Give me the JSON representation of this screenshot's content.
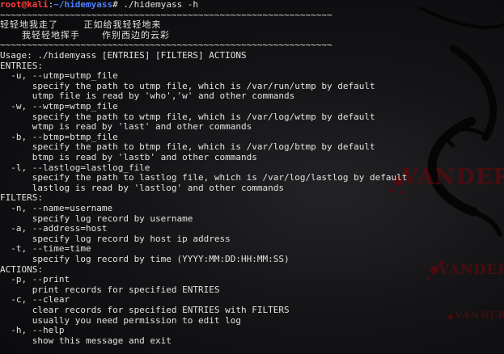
{
  "prompt": {
    "user_host": "root@kali",
    "separator": ":",
    "path": "~/hidemyass",
    "symbol": "#",
    "command": " ./hidemyass -h"
  },
  "banner": {
    "rule": "~~~~~~~~~~~~~~~~~~~~~~~~~~~~~~~~~~~~~~~~~~~~~~~~~~~~~~~~~~~~~~",
    "line1": "轻轻地我走了       正如给我轻轻地来",
    "line2": "      我轻轻地挥手      作别西边的云彩"
  },
  "usage": "Usage: ./hidemyass [ENTRIES] [FILTERS] ACTIONS",
  "sections": {
    "entries": {
      "header": "ENTRIES:",
      "utmp_opt": "  -u, --utmp=utmp_file",
      "utmp_desc1": "      specify the path to utmp file, which is /var/run/utmp by default",
      "utmp_desc2": "      utmp file is read by 'who','w' and other commands",
      "wtmp_opt": "  -w, --wtmp=wtmp_file",
      "wtmp_desc1": "      specify the path to wtmp file, which is /var/log/wtmp by default",
      "wtmp_desc2": "      wtmp is read by 'last' and other commands",
      "btmp_opt": "  -b, --btmp=btmp_file",
      "btmp_desc1": "      specify the path to btmp file, which is /var/log/btmp by default",
      "btmp_desc2": "      btmp is read by 'lastb' and other commands",
      "lastlog_opt": "  -l, --lastlog=lastlog_file",
      "lastlog_desc1": "      specify the path to lastlog file, which is /var/log/lastlog by default",
      "lastlog_desc2": "      lastlog is read by 'lastlog' and other commands"
    },
    "filters": {
      "header": "FILTERS:",
      "name_opt": "  -n, --name=username",
      "name_desc": "      specify log record by username",
      "address_opt": "  -a, --address=host",
      "address_desc": "      specify log record by host ip address",
      "time_opt": "  -t, --time=time",
      "time_desc": "      specify log record by time (YYYY:MM:DD:HH:MM:SS)"
    },
    "actions": {
      "header": "ACTIONS:",
      "print_opt": "  -p, --print",
      "print_desc": "      print records for specified ENTRIES",
      "clear_opt": "  -c, --clear",
      "clear_desc1": "      clear records for specified ENTRIES with FILTERS",
      "clear_desc2": "      usually you need permission to edit log",
      "help_opt": "  -h, --help",
      "help_desc": "      show this message and exit"
    }
  },
  "watermark": {
    "large": "VANDER",
    "medium": "VANDER",
    "small": "VANDER"
  },
  "colors": {
    "background": "#0d0d0f",
    "text": "#e2e2e2",
    "prompt_user": "#ff3d3d",
    "prompt_path": "#4d7fff",
    "watermark": "#5a0a0e"
  }
}
